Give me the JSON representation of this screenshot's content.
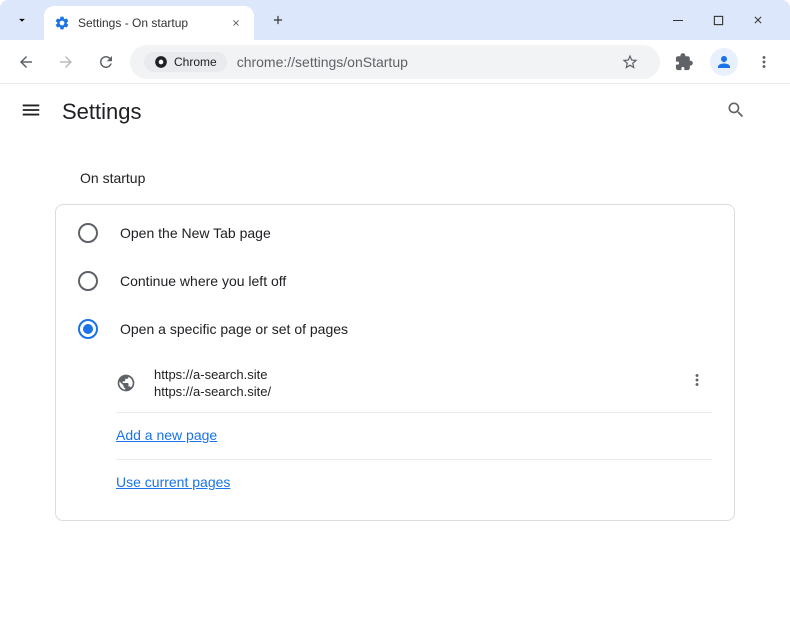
{
  "titlebar": {
    "tab_title": "Settings - On startup"
  },
  "toolbar": {
    "chrome_chip": "Chrome",
    "url": "chrome://settings/onStartup"
  },
  "header": {
    "title": "Settings"
  },
  "section": {
    "title": "On startup"
  },
  "options": {
    "new_tab": "Open the New Tab page",
    "continue": "Continue where you left off",
    "specific": "Open a specific page or set of pages"
  },
  "pages": {
    "line1": "https://a-search.site",
    "line2": "https://a-search.site/"
  },
  "links": {
    "add": "Add a new page",
    "use_current": "Use current pages"
  }
}
